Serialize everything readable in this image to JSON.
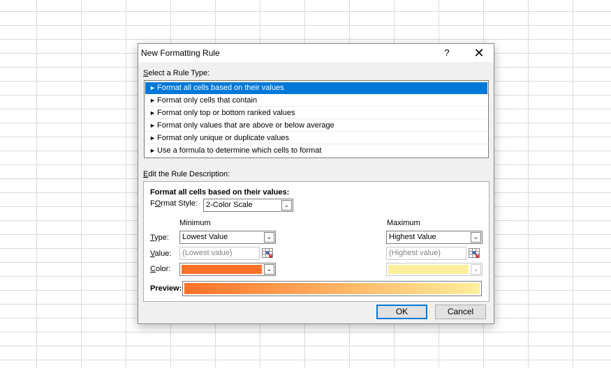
{
  "dialog": {
    "title": "New Formatting Rule",
    "help_label": "?",
    "close_label": "✕",
    "select_rule_type_label_access": "S",
    "select_rule_type_label_rest": "elect a Rule Type:",
    "edit_desc_label_access": "E",
    "edit_desc_label_rest": "dit the Rule Description:"
  },
  "rule_types": [
    {
      "label": "Format all cells based on their values",
      "selected": true
    },
    {
      "label": "Format only cells that contain",
      "selected": false
    },
    {
      "label": "Format only top or bottom ranked values",
      "selected": false
    },
    {
      "label": "Format only values that are above or below average",
      "selected": false
    },
    {
      "label": "Format only unique or duplicate values",
      "selected": false
    },
    {
      "label": "Use a formula to determine which cells to format",
      "selected": false
    }
  ],
  "rule_arrow": "►",
  "description": {
    "heading": "Format all cells based on their values:",
    "format_style_label_access": "O",
    "format_style_label_pre": "F",
    "format_style_label_rest": "rmat Style:",
    "format_style_value": "2-Color Scale",
    "minimum_header": "Minimum",
    "maximum_header": "Maximum",
    "type_label_access": "T",
    "type_label_rest": "ype:",
    "value_label_access": "V",
    "value_label_rest": "alue:",
    "color_label_access": "C",
    "color_label_rest": "olor:",
    "min_type": "Lowest Value",
    "max_type": "Highest Value",
    "min_value_placeholder": "(Lowest value)",
    "max_value_placeholder": "(Highest value)",
    "preview_label": "Preview:"
  },
  "colors": {
    "min_color": "#ff7128",
    "max_color": "#ffef9c",
    "accent": "#0078d7"
  },
  "buttons": {
    "ok": "OK",
    "cancel": "Cancel"
  }
}
